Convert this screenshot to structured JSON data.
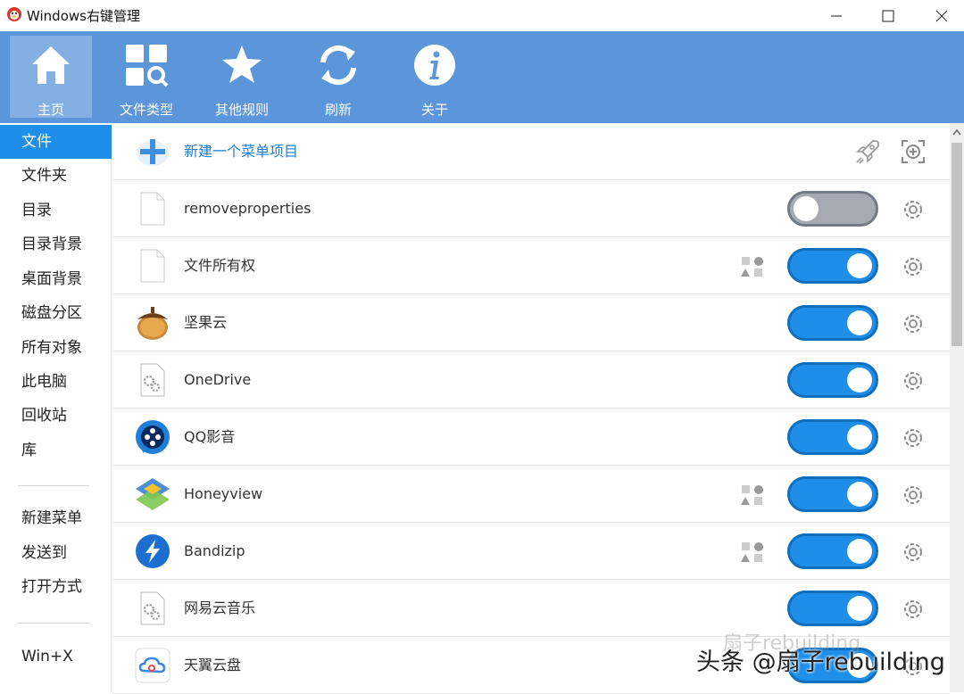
{
  "window": {
    "title": "Windows右键管理"
  },
  "toolbar": {
    "items": [
      {
        "label": "主页",
        "icon": "home-icon",
        "active": true
      },
      {
        "label": "文件类型",
        "icon": "file-type-search-icon",
        "active": false
      },
      {
        "label": "其他规则",
        "icon": "star-icon",
        "active": false
      },
      {
        "label": "刷新",
        "icon": "refresh-icon",
        "active": false
      },
      {
        "label": "关于",
        "icon": "info-icon",
        "active": false
      }
    ]
  },
  "sidebar": {
    "items": [
      "文件",
      "文件夹",
      "目录",
      "目录背景",
      "桌面背景",
      "磁盘分区",
      "所有对象",
      "此电脑",
      "回收站",
      "库"
    ],
    "items2": [
      "新建菜单",
      "发送到",
      "打开方式"
    ],
    "items3": [
      "Win+X"
    ],
    "selected": "文件"
  },
  "main": {
    "new_item_label": "新建一个菜单项目",
    "rows": [
      {
        "label": "removeproperties",
        "icon": "blank-file-icon",
        "enabled": false,
        "shapes": false
      },
      {
        "label": "文件所有权",
        "icon": "blank-file-icon",
        "enabled": true,
        "shapes": true
      },
      {
        "label": "坚果云",
        "icon": "acorn-icon",
        "enabled": true,
        "shapes": false
      },
      {
        "label": "OneDrive",
        "icon": "gear-file-icon",
        "enabled": true,
        "shapes": false
      },
      {
        "label": "QQ影音",
        "icon": "qq-player-icon",
        "enabled": true,
        "shapes": false
      },
      {
        "label": "Honeyview",
        "icon": "honeyview-icon",
        "enabled": true,
        "shapes": true
      },
      {
        "label": "Bandizip",
        "icon": "bandizip-icon",
        "enabled": true,
        "shapes": true
      },
      {
        "label": "网易云音乐",
        "icon": "gear-file-icon",
        "enabled": true,
        "shapes": false
      },
      {
        "label": "天翼云盘",
        "icon": "tianyi-cloud-icon",
        "enabled": true,
        "shapes": false
      }
    ]
  },
  "watermark": {
    "text": "头条 @扇子rebuilding",
    "faint": "扇子rebuilding"
  },
  "colors": {
    "toolbar": "#5b95da",
    "accent": "#1e8ee8",
    "toggle_off": "#a6abb3"
  }
}
